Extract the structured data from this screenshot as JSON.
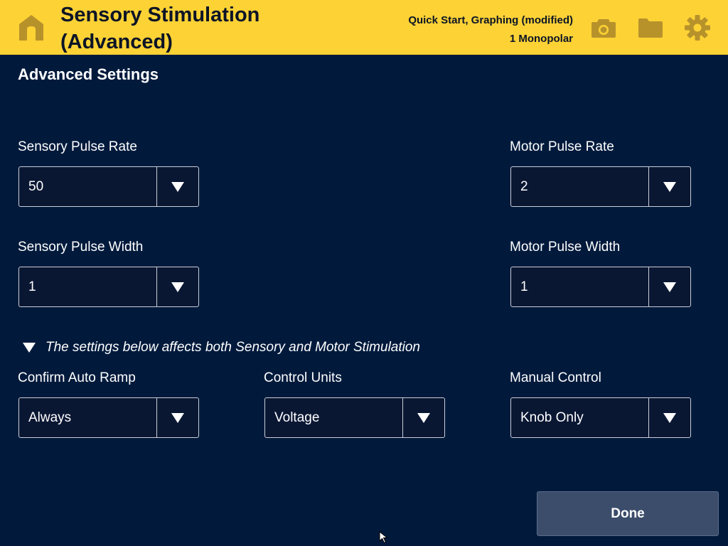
{
  "header": {
    "title_line1": "Sensory Stimulation",
    "title_line2": "(Advanced)",
    "session_name": "Quick Start, Graphing (modified)",
    "electrode": "1 Monopolar",
    "icons": [
      "home-icon",
      "camera-icon",
      "folder-icon",
      "gear-icon"
    ],
    "color": "#fdd235"
  },
  "section": {
    "title": "Advanced Settings"
  },
  "fields": {
    "sensory_pulse_rate": {
      "label": "Sensory Pulse Rate",
      "value": "50"
    },
    "motor_pulse_rate": {
      "label": "Motor Pulse Rate",
      "value": "2"
    },
    "sensory_pulse_width": {
      "label": "Sensory Pulse Width",
      "value": "1"
    },
    "motor_pulse_width": {
      "label": "Motor Pulse Width",
      "value": "1"
    },
    "confirm_auto_ramp": {
      "label": "Confirm Auto Ramp",
      "value": "Always"
    },
    "control_units": {
      "label": "Control Units",
      "value": "Voltage"
    },
    "manual_control": {
      "label": "Manual Control",
      "value": "Knob Only"
    }
  },
  "note": {
    "text": "The settings below affects both Sensory and Motor Stimulation"
  },
  "actions": {
    "done_label": "Done"
  },
  "colors": {
    "background": "#011a3c",
    "header": "#fdd235",
    "button": "#3b4d6b"
  }
}
